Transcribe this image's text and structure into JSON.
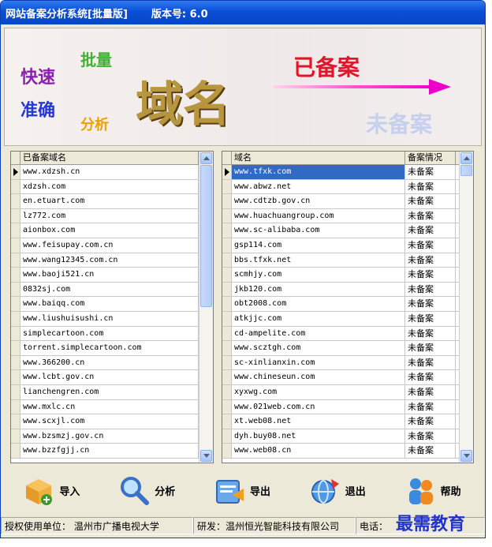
{
  "window": {
    "title": "网站备案分析系统[批量版]",
    "version": "版本号: 6.0"
  },
  "banner": {
    "w1": "快速",
    "w2": "准确",
    "w3": "批量",
    "w4": "分析",
    "main": "域名",
    "registered": "已备案",
    "unregistered": "未备案"
  },
  "left_grid": {
    "header": "已备案域名",
    "rows": [
      "www.xdzsh.cn",
      "xdzsh.com",
      "en.etuart.com",
      "lz772.com",
      "aionbox.com",
      "www.feisupay.com.cn",
      "www.wang12345.com.cn",
      "www.baoji521.cn",
      "0832sj.com",
      "www.baiqq.com",
      "www.liushuisushi.cn",
      "simplecartoon.com",
      "torrent.simplecartoon.com",
      "www.366200.cn",
      "www.lcbt.gov.cn",
      "lianchengren.com",
      "www.mxlc.cn",
      "www.scxjl.com",
      "www.bzsmzj.gov.cn",
      "www.bzzfgjj.cn"
    ]
  },
  "right_grid": {
    "header_domain": "域名",
    "header_status": "备案情况",
    "status_value": "未备案",
    "rows": [
      "www.tfxk.com",
      "www.abwz.net",
      "www.cdtzb.gov.cn",
      "www.huachuangroup.com",
      "www.sc-alibaba.com",
      "gsp114.com",
      "bbs.tfxk.net",
      "scmhjy.com",
      "jkb120.com",
      "obt2008.com",
      "atkjjc.com",
      "cd-ampelite.com",
      "www.scztgh.com",
      "sc-xinlianxin.com",
      "www.chineseun.com",
      "xyxwg.com",
      "www.021web.com.cn",
      "xt.web08.net",
      "dyh.buy08.net",
      "www.web08.cn"
    ]
  },
  "toolbar": {
    "import": "导入",
    "analyze": "分析",
    "export": "导出",
    "exit": "退出",
    "help": "帮助"
  },
  "status": {
    "licensee": "授权使用单位： 温州市广播电视大学",
    "developer": "研发：温州恒光智能科技有限公司",
    "phone": "电话："
  },
  "watermark": "最需教育"
}
